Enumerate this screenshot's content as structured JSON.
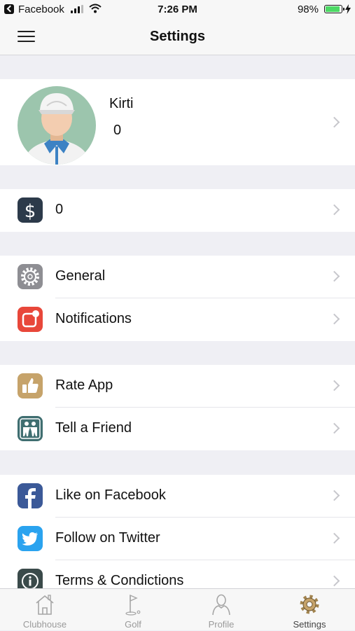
{
  "status_bar": {
    "back_app": "Facebook",
    "time": "7:26 PM",
    "battery_percent": "98%",
    "battery_level": 0.98
  },
  "nav": {
    "title": "Settings"
  },
  "profile": {
    "name": "Kirti",
    "score": "0"
  },
  "balance": {
    "icon": "dollar-icon",
    "value": "0",
    "color": "#2c3a4a"
  },
  "groups": [
    [
      {
        "key": "general",
        "label": "General",
        "icon": "gear-icon",
        "color": "#8e8e93"
      },
      {
        "key": "notifications",
        "label": "Notifications",
        "icon": "notification-icon",
        "color": "#e8473a"
      }
    ],
    [
      {
        "key": "rate-app",
        "label": "Rate App",
        "icon": "thumbs-up-icon",
        "color": "#c6a36a"
      },
      {
        "key": "tell-a-friend",
        "label": "Tell a Friend",
        "icon": "friends-icon",
        "color": "#3f6e70"
      }
    ],
    [
      {
        "key": "facebook",
        "label": "Like on Facebook",
        "icon": "facebook-icon",
        "color": "#3b5998"
      },
      {
        "key": "twitter",
        "label": "Follow on Twitter",
        "icon": "twitter-icon",
        "color": "#2aa3ef"
      },
      {
        "key": "terms",
        "label": "Terms & Condictions",
        "icon": "info-icon",
        "color": "#3a4a4a"
      }
    ]
  ],
  "tabs": [
    {
      "label": "Clubhouse",
      "icon": "clubhouse-icon",
      "active": false
    },
    {
      "label": "Golf",
      "icon": "golf-flag-icon",
      "active": false
    },
    {
      "label": "Profile",
      "icon": "profile-icon",
      "active": false
    },
    {
      "label": "Settings",
      "icon": "settings-gear-icon",
      "active": true
    }
  ]
}
